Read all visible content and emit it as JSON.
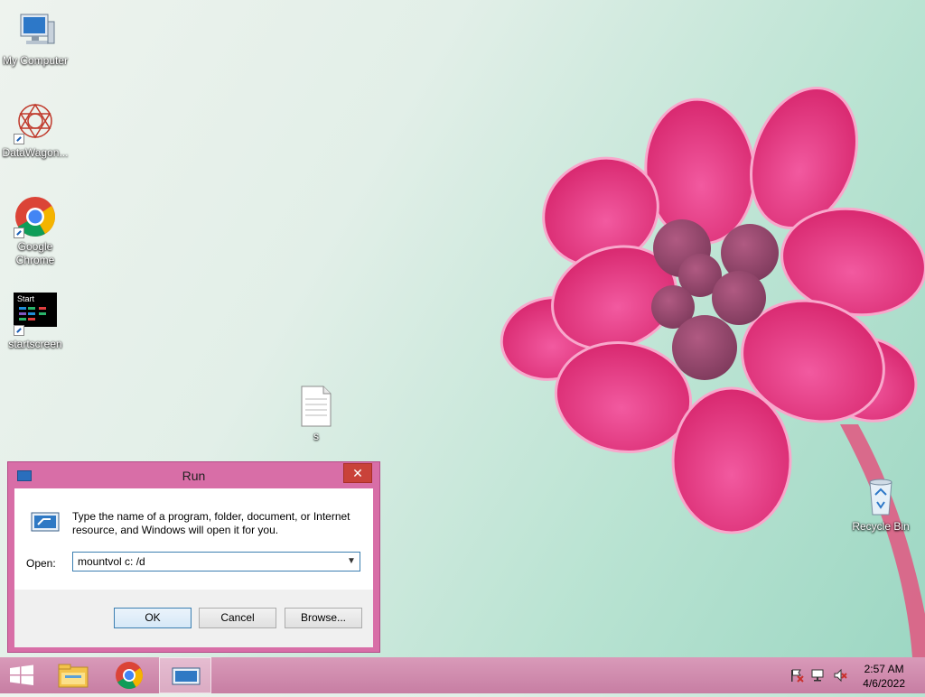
{
  "desktop": {
    "icons": [
      {
        "label": "My Computer"
      },
      {
        "label": "DataWagon..."
      },
      {
        "label": "Google Chrome"
      },
      {
        "label": "startscreen",
        "tile_text": "Start"
      },
      {
        "label": "s"
      },
      {
        "label": "Recycle Bin"
      }
    ]
  },
  "run_dialog": {
    "title": "Run",
    "close_glyph": "✕",
    "description": "Type the name of a program, folder, document, or Internet resource, and Windows will open it for you.",
    "open_label": "Open:",
    "open_value": "mountvol c: /d",
    "buttons": {
      "ok": "OK",
      "cancel": "Cancel",
      "browse": "Browse..."
    }
  },
  "taskbar": {
    "clock_time": "2:57 AM",
    "clock_date": "4/6/2022",
    "icons": [
      "windows-start-icon",
      "file-explorer-icon",
      "chrome-icon",
      "run-icon"
    ],
    "tray": [
      "action-center-flag-icon",
      "network-icon",
      "volume-muted-icon"
    ]
  },
  "colors": {
    "dialog_frame": "#d86ea7",
    "taskbar": "#cf8bae",
    "close_button": "#c9423a",
    "flower": "#e0367a"
  }
}
